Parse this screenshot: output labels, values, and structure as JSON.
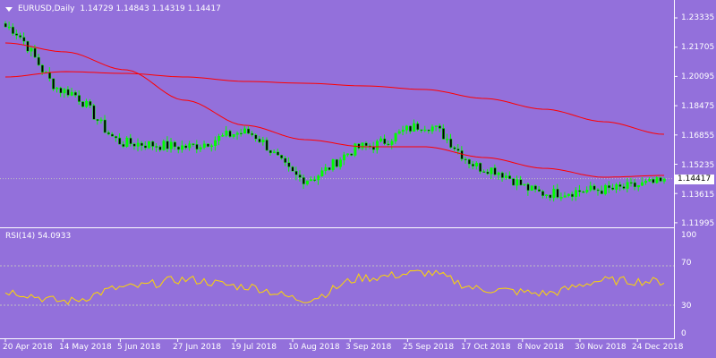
{
  "header": {
    "symbol": "EURUSD,Daily",
    "ohlc": "1.14729 1.14843 1.14319 1.14417"
  },
  "price_axis": {
    "ticks": [
      "1.23335",
      "1.21705",
      "1.20095",
      "1.18475",
      "1.16855",
      "1.15235",
      "1.13615",
      "1.11995"
    ],
    "current": "1.14417"
  },
  "rsi_panel": {
    "label": "RSI(14) 54.0933",
    "ticks": [
      "100",
      "70",
      "30",
      "0"
    ]
  },
  "time_axis": {
    "ticks": [
      "20 Apr 2018",
      "14 May 2018",
      "5 Jun 2018",
      "27 Jun 2018",
      "19 Jul 2018",
      "10 Aug 2018",
      "3 Sep 2018",
      "25 Sep 2018",
      "17 Oct 2018",
      "8 Nov 2018",
      "30 Nov 2018",
      "24 Dec 2018"
    ]
  },
  "colors": {
    "background": "#9370db",
    "bull_candle": "#00ff00",
    "ma_lines": "#ff0000",
    "rsi_line": "#ffd700",
    "axis": "#ffffff",
    "level_lines": "#c0c0c0"
  },
  "chart_data": [
    {
      "type": "line",
      "title": "EURUSD,Daily",
      "description_of_series": "approximate daily close",
      "x": [
        "20 Apr 2018",
        "14 May 2018",
        "5 Jun 2018",
        "27 Jun 2018",
        "19 Jul 2018",
        "10 Aug 2018",
        "3 Sep 2018",
        "25 Sep 2018",
        "17 Oct 2018",
        "8 Nov 2018",
        "30 Nov 2018",
        "24 Dec 2018"
      ],
      "series": [
        {
          "values": [
            1.229,
            1.193,
            1.164,
            1.162,
            1.17,
            1.144,
            1.162,
            1.174,
            1.15,
            1.136,
            1.138,
            1.142
          ]
        },
        {
          "values": [
            1.22,
            1.215,
            1.205,
            1.188,
            1.174,
            1.166,
            1.162,
            1.162,
            1.156,
            1.15,
            1.145,
            1.146
          ]
        },
        {
          "values": [
            1.201,
            1.204,
            1.203,
            1.201,
            1.1985,
            1.1975,
            1.196,
            1.194,
            1.189,
            1.183,
            1.176,
            1.169
          ]
        }
      ],
      "ylim": [
        1.118,
        1.238
      ]
    },
    {
      "type": "line",
      "title": "RSI(14) 54.0933",
      "x": [
        "20 Apr 2018",
        "14 May 2018",
        "5 Jun 2018",
        "27 Jun 2018",
        "19 Jul 2018",
        "10 Aug 2018",
        "3 Sep 2018",
        "25 Sep 2018",
        "17 Oct 2018",
        "8 Nov 2018",
        "30 Nov 2018",
        "24 Dec 2018"
      ],
      "series": [
        {
          "values": [
            44,
            34,
            48,
            56,
            49,
            36,
            58,
            63,
            46,
            42,
            55,
            54
          ]
        }
      ],
      "ylim": [
        0,
        100
      ],
      "levels": [
        30,
        70
      ]
    }
  ]
}
